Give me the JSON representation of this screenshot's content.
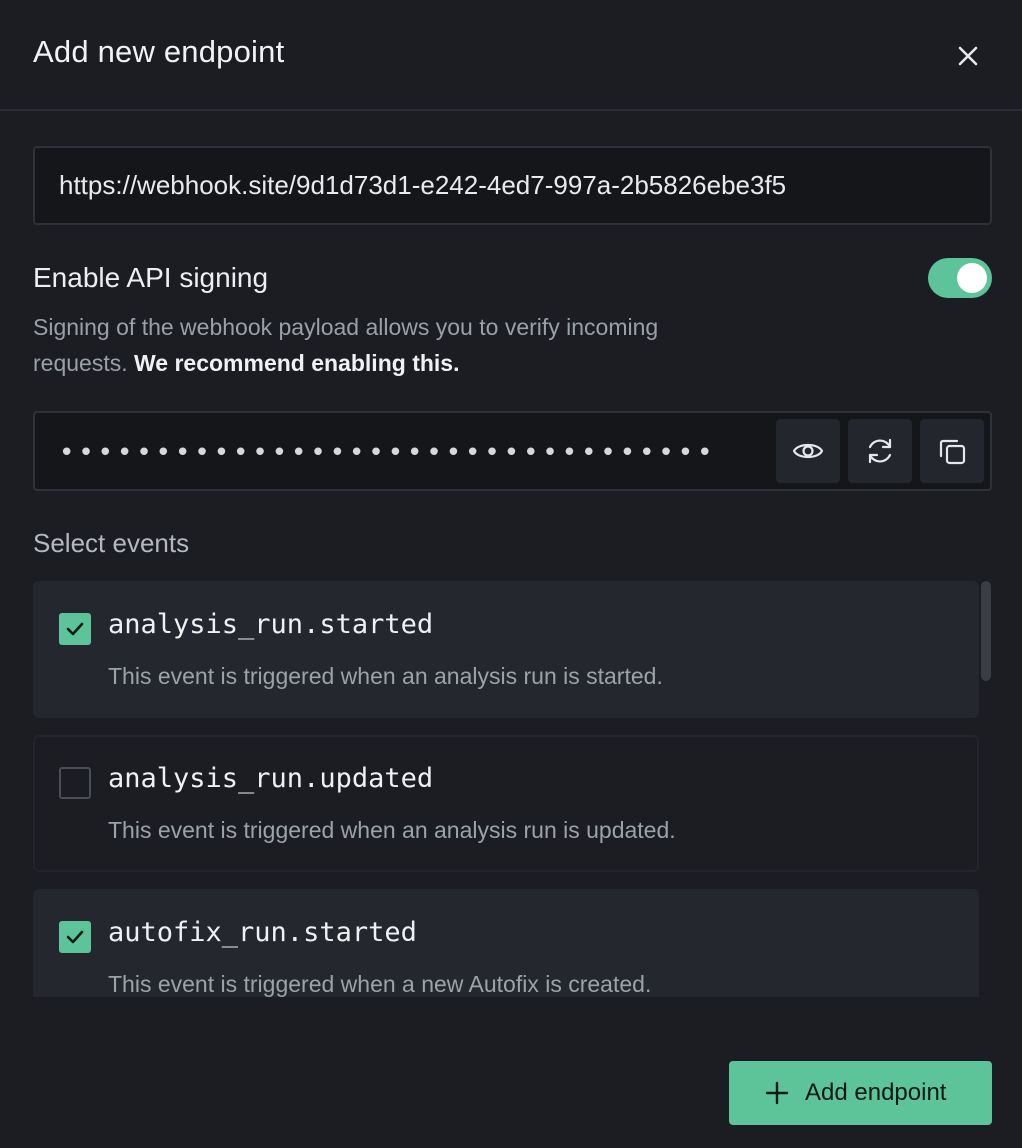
{
  "dialog": {
    "title": "Add new endpoint"
  },
  "url_field": {
    "value": "https://webhook.site/9d1d73d1-e242-4ed7-997a-2b5826ebe3f5"
  },
  "signing": {
    "title": "Enable API signing",
    "enabled": true,
    "description": "Signing of the webhook payload allows you to verify incoming requests.",
    "recommendation": "We recommend enabling this."
  },
  "secret": {
    "masked_value": "••••••••••••••••••••••••••••••••••"
  },
  "events": {
    "label": "Select events",
    "items": [
      {
        "name": "analysis_run.started",
        "description": "This event is triggered when an analysis run is started.",
        "checked": true
      },
      {
        "name": "analysis_run.updated",
        "description": "This event is triggered when an analysis run is updated.",
        "checked": false
      },
      {
        "name": "autofix_run.started",
        "description": "This event is triggered when a new Autofix is created.",
        "checked": true
      }
    ]
  },
  "actions": {
    "add_label": "Add endpoint"
  },
  "colors": {
    "accent": "#5dc398",
    "background": "#1b1d22",
    "card_selected": "#24272e"
  },
  "icons": [
    "close-icon",
    "eye-icon",
    "refresh-icon",
    "copy-icon",
    "check-icon",
    "plus-icon"
  ]
}
